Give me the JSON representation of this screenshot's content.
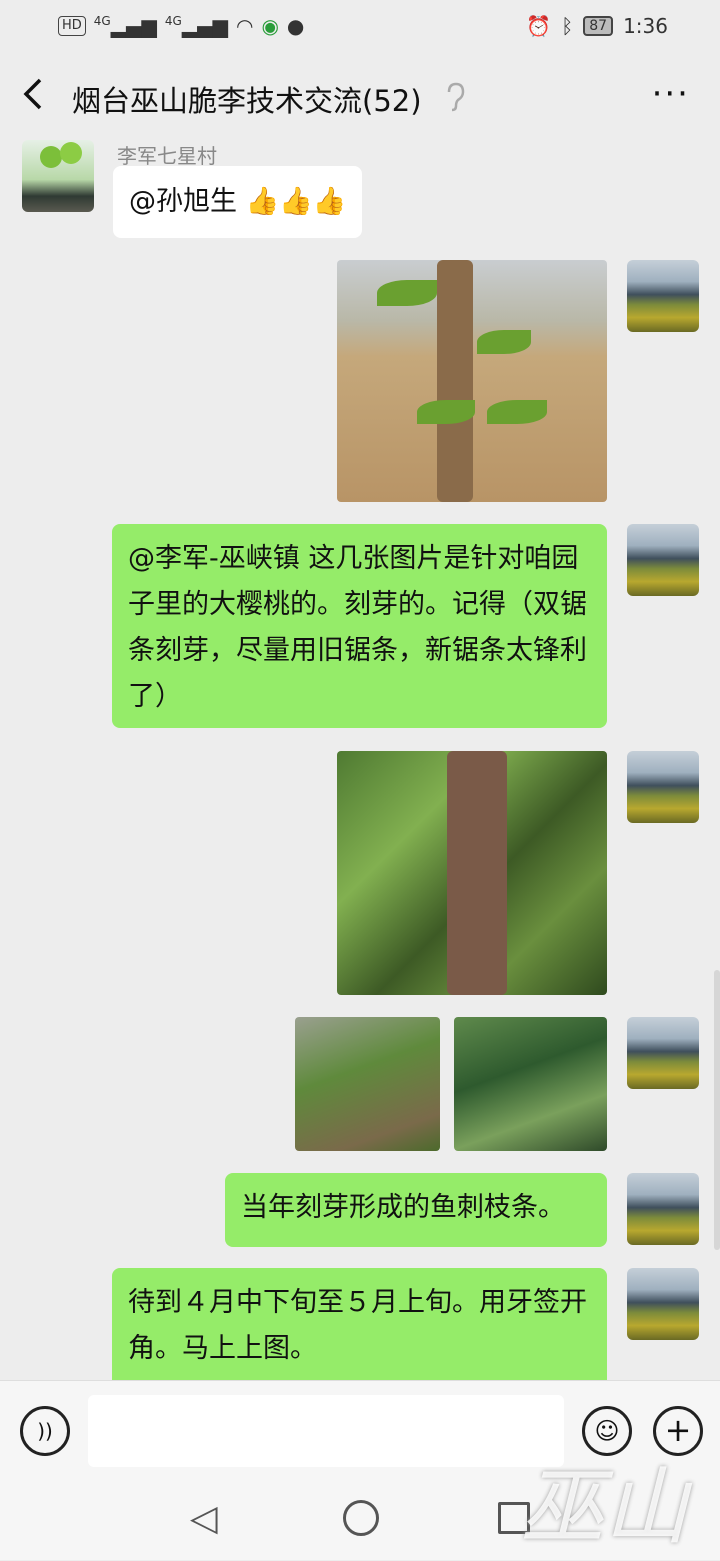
{
  "status_bar": {
    "left_icons": [
      "HD",
      "4G",
      "4G"
    ],
    "battery": "87",
    "time": "1:36"
  },
  "header": {
    "title": "烟台巫山脆李技术交流(52)",
    "more_label": "···"
  },
  "messages": {
    "m1": {
      "sender": "李军七星村",
      "text": "@孙旭生 👍👍👍"
    },
    "m3": {
      "text": "@李军-巫峡镇 这几张图片是针对咱园子里的大樱桃的。刻芽的。记得（双锯条刻芽，尽量用旧锯条，新锯条太锋利了）"
    },
    "m6": {
      "text": "当年刻芽形成的鱼刺枝条。"
    },
    "m7": {
      "text": "待到４月中下旬至５月上旬。用牙签开角。马上上图。"
    }
  },
  "input_bar": {
    "placeholder": ""
  },
  "watermark": {
    "text": "巫山"
  }
}
